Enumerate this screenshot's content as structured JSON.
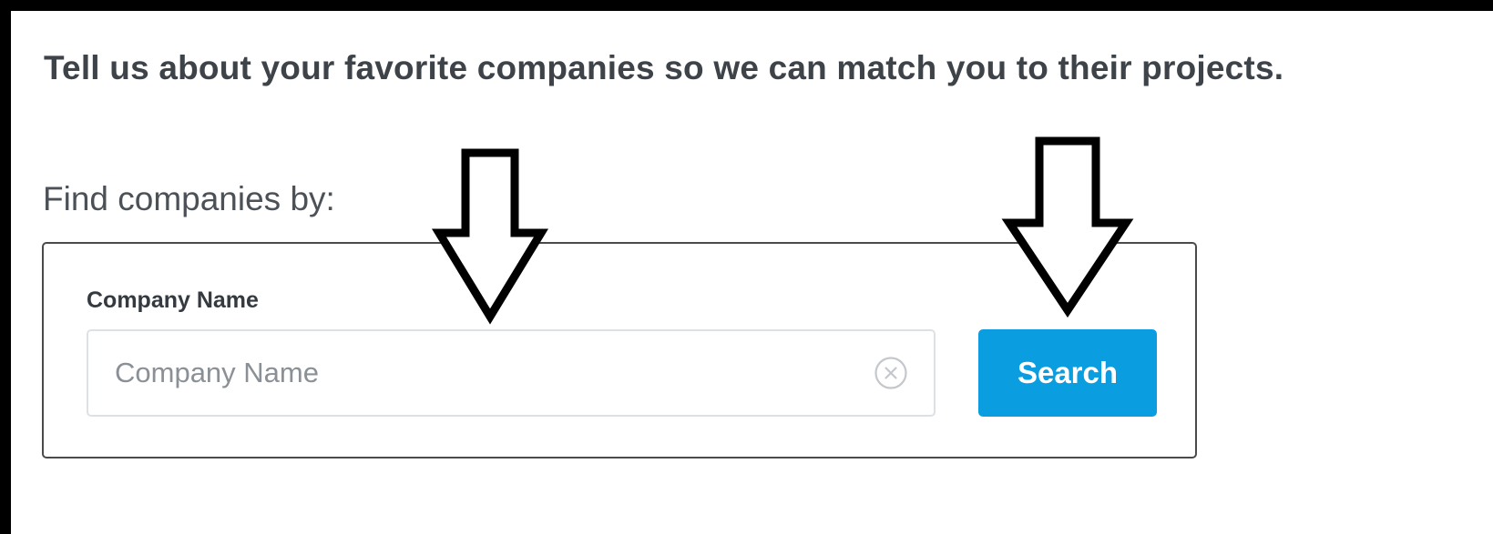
{
  "headline": "Tell us about your favorite companies so we can match you to their projects.",
  "find_by_label": "Find companies by:",
  "search_panel": {
    "field_label": "Company Name",
    "input_value": "",
    "input_placeholder": "Company Name",
    "clear_icon": "clear-circle-x-icon",
    "search_button_label": "Search"
  },
  "annotations": {
    "arrow_icon": "down-arrow-outline-icon",
    "count": 2
  },
  "colors": {
    "frame_border": "#000000",
    "background": "#ffffff",
    "headline_text": "#3d4349",
    "search_button": "#0a9ddf",
    "search_button_text": "#ffffff",
    "panel_border": "#4a4a4a",
    "input_border": "#dde1e4",
    "placeholder_text": "#8a9096"
  }
}
